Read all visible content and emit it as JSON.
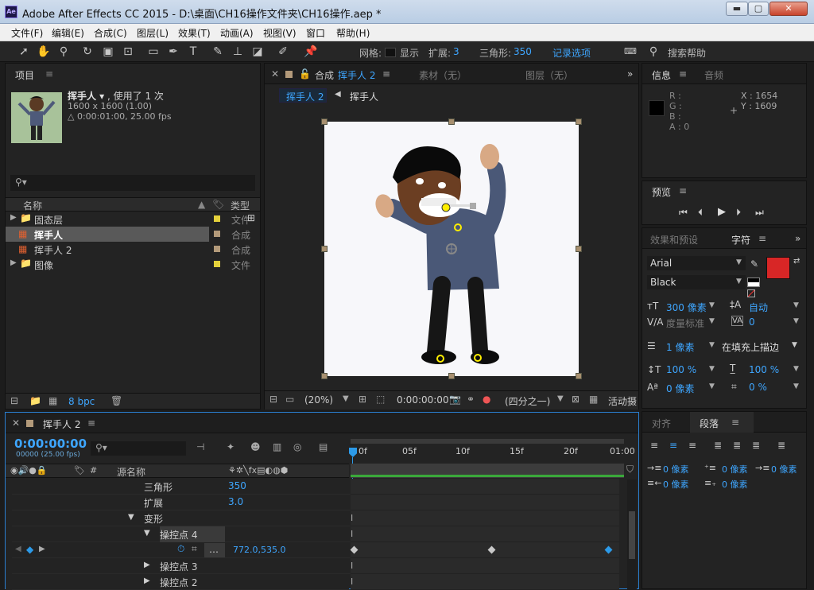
{
  "window": {
    "title": "Adobe After Effects CC 2015 - D:\\桌面\\CH16操作文件夹\\CH16操作.aep *",
    "logo": "Ae"
  },
  "winbtns": {
    "min": "▬",
    "max": "▢",
    "close": "✕"
  },
  "menu": [
    "文件(F)",
    "编辑(E)",
    "合成(C)",
    "图层(L)",
    "效果(T)",
    "动画(A)",
    "视图(V)",
    "窗口",
    "帮助(H)"
  ],
  "toolbar": {
    "mesh_label": "网格:",
    "show_label": "显示",
    "expand_label": "扩展:",
    "expand_value": "3",
    "tri_label": "三角形:",
    "tri_value": "350",
    "record_label": "记录选项",
    "search_label": "搜索帮助"
  },
  "project": {
    "title": "项目",
    "item_name": "挥手人 ▾",
    "used": ", 使用了 1 次",
    "dims": "1600 x 1600 (1.00)",
    "duration": "△ 0:00:01:00, 25.00 fps",
    "col_name": "名称",
    "col_type": "类型",
    "items": [
      {
        "name": "固态层",
        "type": "文件",
        "color": "#e4d13b",
        "kind": "folder"
      },
      {
        "name": "挥手人",
        "type": "合成",
        "color": "#b39a7a",
        "kind": "comp"
      },
      {
        "name": "挥手人 2",
        "type": "合成",
        "color": "#b39a7a",
        "kind": "comp"
      },
      {
        "name": "图像",
        "type": "文件",
        "color": "#e4d13b",
        "kind": "folder"
      }
    ],
    "bpc": "8 bpc"
  },
  "comp": {
    "tab_prefix": "合成",
    "tab_name": "挥手人 2",
    "tab_footage": "素材（无）",
    "tab_layer": "图层（无）",
    "crumb_active": "挥手人 2",
    "crumb_next": "挥手人",
    "zoom": "(20%)",
    "time": "0:00:00:00",
    "quality": "(四分之一)",
    "active_cam": "活动摄"
  },
  "info": {
    "title": "信息",
    "audio_tab": "音频",
    "r": "R :",
    "g": "G :",
    "b": "B :",
    "a": "A : 0",
    "x": "X : 1654",
    "y": "Y : 1609"
  },
  "preview": {
    "title": "预览"
  },
  "character": {
    "effects_tab": "效果和预设",
    "char_tab": "字符",
    "font": "Arial",
    "style": "Black",
    "size": "300 像素",
    "leading": "自动",
    "kerning": "度量标准",
    "tracking": "0",
    "stroke": "1 像素",
    "stroke_mode": "在填充上描边",
    "vscale": "100 %",
    "hscale": "100 %",
    "baseline": "0 像素",
    "tsume": "0 %",
    "fill_color": "#d82626"
  },
  "paragraph": {
    "align_tab": "对齐",
    "para_tab": "段落",
    "indent_left": "0 像素",
    "indent_first": "0 像素",
    "indent_right": "0 像素",
    "space_before": "0 像素",
    "space_after": "0 像素"
  },
  "timeline": {
    "tab_name": "挥手人 2",
    "timecode": "0:00:00:00",
    "frames": "00000 (25.00 fps)",
    "col_source": "源名称",
    "ruler": [
      "0f",
      "05f",
      "10f",
      "15f",
      "20f",
      "01:00"
    ],
    "rows": [
      {
        "label": "三角形",
        "value": "350"
      },
      {
        "label": "扩展",
        "value": "3.0"
      },
      {
        "label": "变形",
        "value": ""
      },
      {
        "label": "操控点 4",
        "value": ""
      },
      {
        "label": "",
        "value": "772.0,535.0"
      },
      {
        "label": "操控点 3",
        "value": ""
      },
      {
        "label": "操控点 2",
        "value": ""
      }
    ]
  }
}
